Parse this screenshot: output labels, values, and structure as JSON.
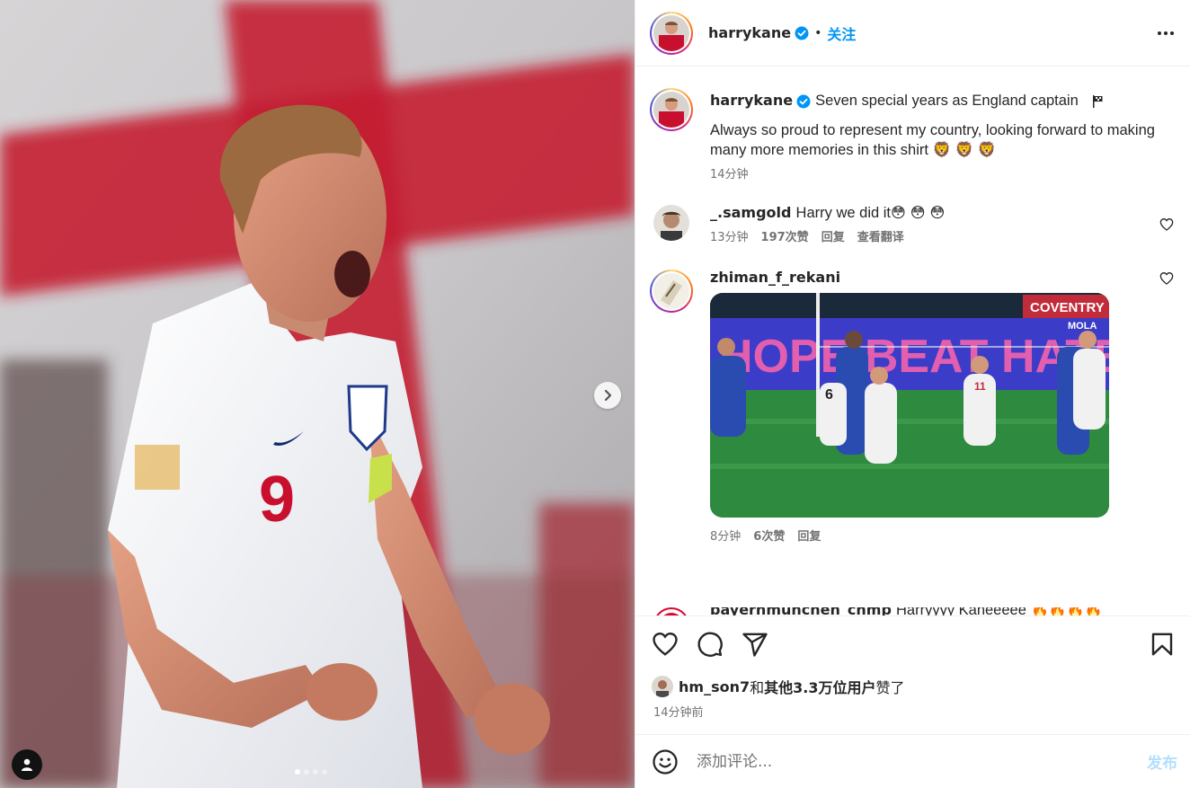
{
  "post": {
    "username": "harrykane",
    "follow_label": "关注",
    "dot": "•",
    "more_icon": "more-horizontal-icon"
  },
  "caption": {
    "username": "harrykane",
    "line1": "Seven special years as England captain",
    "flag_icon": "checkered-flag-icon",
    "line2": "Always so proud to represent my country, looking forward to making many more memories in this shirt",
    "emojis": "🦁 🦁 🦁",
    "time": "14分钟"
  },
  "comments": [
    {
      "username": "_.samgold",
      "text": "Harry we did it",
      "emojis": "😳 😳 😳",
      "time": "13分钟",
      "likes": "197次赞",
      "reply": "回复",
      "translate": "查看翻译"
    },
    {
      "username": "zhiman_f_rekani",
      "time": "8分钟",
      "likes": "6次赞",
      "reply": "回复",
      "gif_banner_text": "HOPE BEAT HATE",
      "gif_ad": "COVENTRY",
      "gif_ad2": "MOLA",
      "gif_player_numbers": [
        "6",
        "11"
      ]
    },
    {
      "username": "bayernmunchen_chmp",
      "text": "Harryyyy Kaneeeee",
      "emojis": "🔥🔥🔥🔥"
    }
  ],
  "likes_line": {
    "user": "hm_son7",
    "and": "和",
    "others": "其他3.3万位用户",
    "suffix": "赞了"
  },
  "post_time": "14分钟前",
  "add_comment": {
    "placeholder": "添加评论...",
    "post_label": "发布",
    "emoji_icon": "smiley-icon"
  },
  "media": {
    "shirt_number": "9",
    "carousel_index": 1,
    "carousel_count": 4
  },
  "colors": {
    "accent": "#0095f6",
    "post_disabled": "#b2dffc",
    "muted": "#737373",
    "flag_red": "#c8102e"
  }
}
